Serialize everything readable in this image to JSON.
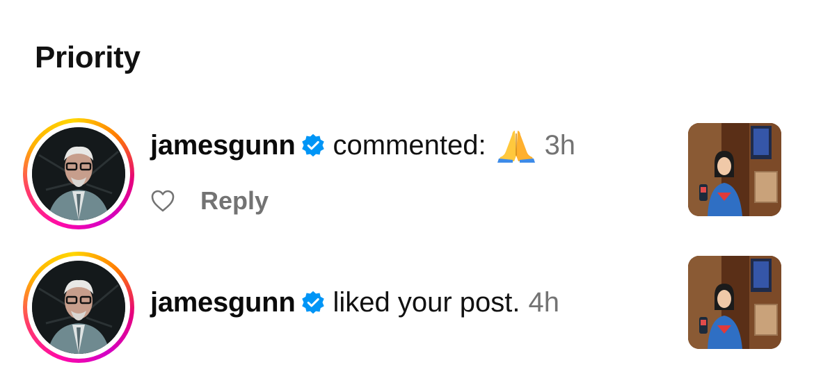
{
  "section": {
    "title": "Priority"
  },
  "notifications": [
    {
      "username": "jamesgunn",
      "action": "commented:",
      "emoji": "🙏",
      "time": "3h",
      "reply_label": "Reply",
      "avatar_icon": "profile-photo",
      "verified_icon": "verified-badge-icon"
    },
    {
      "username": "jamesgunn",
      "action": "liked your post.",
      "time": "4h",
      "avatar_icon": "profile-photo",
      "verified_icon": "verified-badge-icon"
    }
  ],
  "colors": {
    "verified": "#0095f6",
    "muted_text": "#737373",
    "story_ring_start": "#ffd600",
    "story_ring_end": "#d300c5"
  }
}
